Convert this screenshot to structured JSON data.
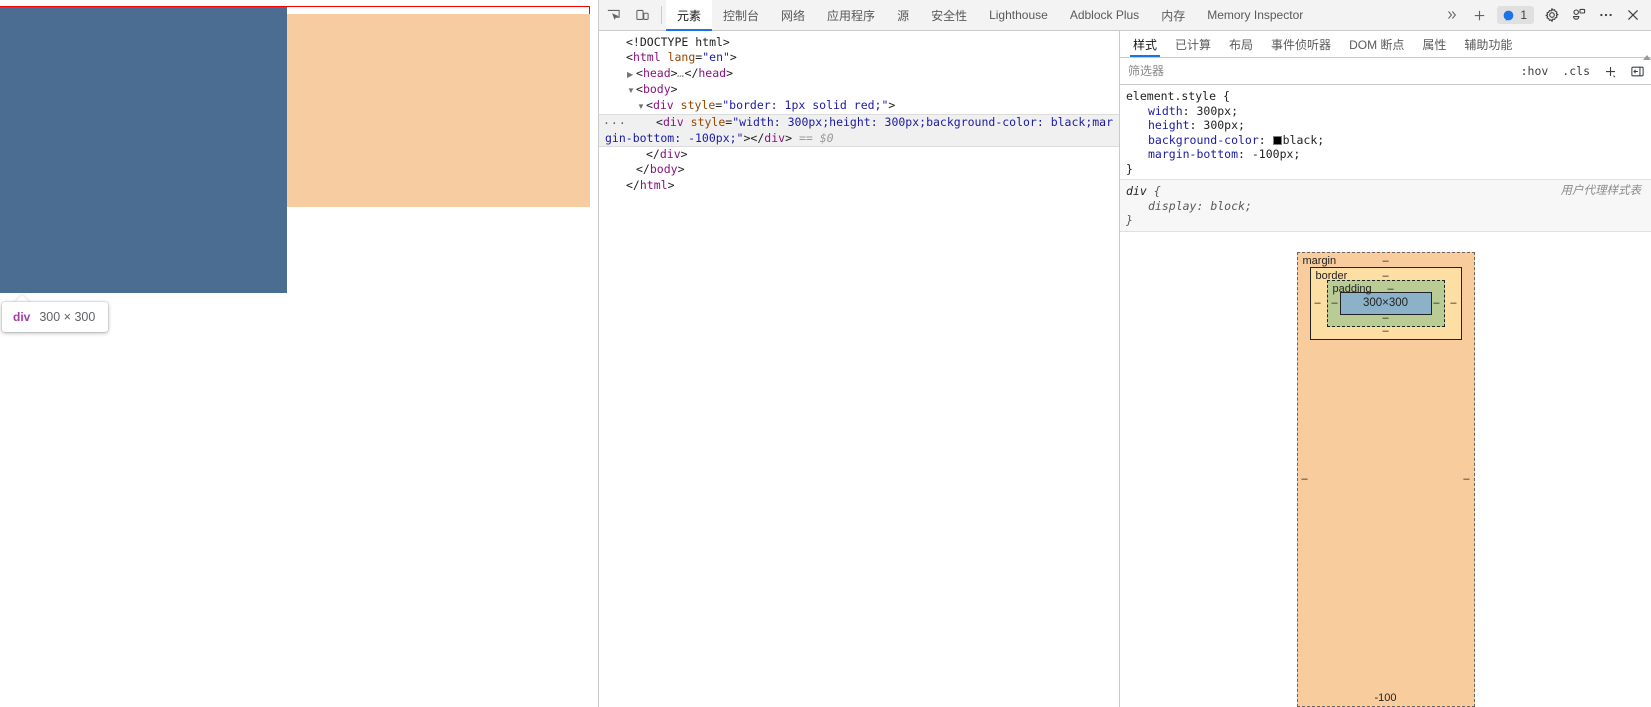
{
  "viewport": {
    "inspect_tooltip": {
      "tag": "div",
      "dimensions": "300 × 300"
    },
    "colors": {
      "content_overlay": "#4a6d91",
      "margin_overlay": "#f7cca0",
      "red_border": "#ff0000"
    }
  },
  "devtools": {
    "toolbar": {
      "inspect_icon": "inspect-element-icon",
      "device_toolbar_icon": "device-toolbar-icon",
      "tabs": [
        {
          "label": "元素",
          "active": true
        },
        {
          "label": "控制台",
          "active": false
        },
        {
          "label": "网络",
          "active": false
        },
        {
          "label": "应用程序",
          "active": false
        },
        {
          "label": "源",
          "active": false
        },
        {
          "label": "安全性",
          "active": false
        },
        {
          "label": "Lighthouse",
          "active": false
        },
        {
          "label": "Adblock Plus",
          "active": false
        },
        {
          "label": "内存",
          "active": false
        },
        {
          "label": "Memory Inspector",
          "active": false
        }
      ],
      "more_tabs_icon": "chevron-double-right-icon",
      "add_tab_icon": "plus-icon",
      "issues_count": "1",
      "issues_icon": "issues-icon",
      "settings_icon": "gear-icon",
      "customize_icon": "devices-icon",
      "more_options_icon": "more-vertical-icon",
      "close_icon": "close-icon"
    },
    "dom_tree": {
      "lines": [
        {
          "indent": 0,
          "twisty": "",
          "text": "<!DOCTYPE html>"
        },
        {
          "indent": 0,
          "twisty": "",
          "text": "<html lang=\"en\">"
        },
        {
          "indent": 1,
          "twisty": "▶",
          "text": "<head>…</head>"
        },
        {
          "indent": 1,
          "twisty": "▼",
          "text": "<body>"
        },
        {
          "indent": 2,
          "twisty": "▼",
          "text": "<div style=\"border: 1px solid red;\">"
        },
        {
          "indent": 3,
          "twisty": "",
          "text": "<div style=\"width: 300px;height: 300px;background-color: black;margin-bottom: -100px;\"></div> == $0",
          "selected": true,
          "gutter": "···"
        },
        {
          "indent": 2,
          "twisty": "",
          "text": "</div>"
        },
        {
          "indent": 1,
          "twisty": "",
          "text": "</body>"
        },
        {
          "indent": 0,
          "twisty": "",
          "text": "</html>"
        }
      ],
      "selected_marker": "== $0"
    },
    "styles": {
      "tabs": [
        {
          "label": "样式",
          "active": true
        },
        {
          "label": "已计算",
          "active": false
        },
        {
          "label": "布局",
          "active": false
        },
        {
          "label": "事件侦听器",
          "active": false
        },
        {
          "label": "DOM 断点",
          "active": false
        },
        {
          "label": "属性",
          "active": false
        },
        {
          "label": "辅助功能",
          "active": false
        }
      ],
      "filter_placeholder": "筛选器",
      "filter_value": "",
      "hov_label": ":hov",
      "cls_label": ".cls",
      "new_rule_icon": "plus-icon",
      "sidebar_toggle_icon": "panel-toggle-icon",
      "rules": [
        {
          "selector": "element.style",
          "origin": "",
          "declarations": [
            {
              "property": "width",
              "value": "300px",
              "swatch": false
            },
            {
              "property": "height",
              "value": "300px",
              "swatch": false
            },
            {
              "property": "background-color",
              "value": "black",
              "swatch": true,
              "swatch_color": "#000000"
            },
            {
              "property": "margin-bottom",
              "value": "-100px",
              "swatch": false
            }
          ]
        },
        {
          "selector": "div",
          "origin": "用户代理样式表",
          "ua": true,
          "declarations": [
            {
              "property": "display",
              "value": "block",
              "swatch": false
            }
          ]
        }
      ]
    },
    "box_model": {
      "margin_label": "margin",
      "border_label": "border",
      "padding_label": "padding",
      "content_size": "300×300",
      "margin": {
        "top": "–",
        "right": "–",
        "bottom": "-100",
        "left": "–"
      },
      "border": {
        "top": "–",
        "right": "–",
        "bottom": "–",
        "left": "–"
      },
      "padding": {
        "top": "–",
        "right": "–",
        "bottom": "–",
        "left": "–"
      },
      "colors": {
        "margin": "#f9cc9d",
        "border": "#fddfa3",
        "padding": "#b9cc96",
        "content": "#8cb2c9"
      }
    }
  }
}
